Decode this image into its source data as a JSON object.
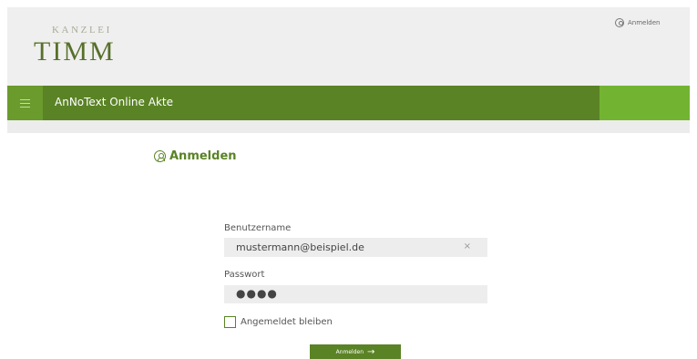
{
  "header": {
    "logo_top": "KANZLEI",
    "logo_main": "TIMM",
    "login_link": "Anmelden",
    "login_icon": "user-circle-icon"
  },
  "navbar": {
    "menu_icon": "hamburger-menu-icon",
    "title": "AnNoText Online Akte"
  },
  "login": {
    "title": "Anmelden",
    "title_icon": "user-circle-icon",
    "username_label": "Benutzername",
    "username_value": "mustermann@beispiel.de",
    "password_label": "Passwort",
    "password_value": "●●●●",
    "remember_label": "Angemeldet bleiben",
    "remember_checked": false,
    "submit_label": "Anmelden",
    "submit_icon": "arrow-right-icon",
    "clear_symbol": "×"
  },
  "colors": {
    "primary": "#5a8325",
    "accent": "#72b432",
    "header_bg": "#efefef"
  }
}
